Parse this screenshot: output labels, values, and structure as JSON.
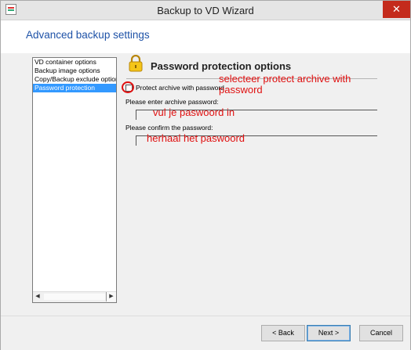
{
  "window": {
    "title": "Backup to VD Wizard",
    "close_glyph": "✕"
  },
  "header": {
    "title": "Advanced backup settings"
  },
  "sidebar": {
    "items": [
      {
        "label": "VD container options"
      },
      {
        "label": "Backup image options"
      },
      {
        "label": "Copy/Backup exclude options"
      },
      {
        "label": "Password protection"
      }
    ]
  },
  "scroll": {
    "left_glyph": "◀",
    "right_glyph": "▶"
  },
  "section": {
    "title": "Password protection options",
    "icon": "lock-icon"
  },
  "form": {
    "protect_label": "Protect archive with password",
    "protect_checked": false,
    "password_label": "Please enter archive password:",
    "password_value": "",
    "confirm_label": "Please confirm the password:",
    "confirm_value": ""
  },
  "annotations": {
    "select_protect": "selecteer protect archive with password",
    "enter_password": "vul je paswoord in",
    "repeat_password": "herhaal het paswoord"
  },
  "buttons": {
    "back": "< Back",
    "next": "Next >",
    "cancel": "Cancel"
  },
  "colors": {
    "header_title": "#1e52a7",
    "selection": "#3399ff",
    "annotation": "#e01010",
    "close_button": "#c42b1c"
  }
}
